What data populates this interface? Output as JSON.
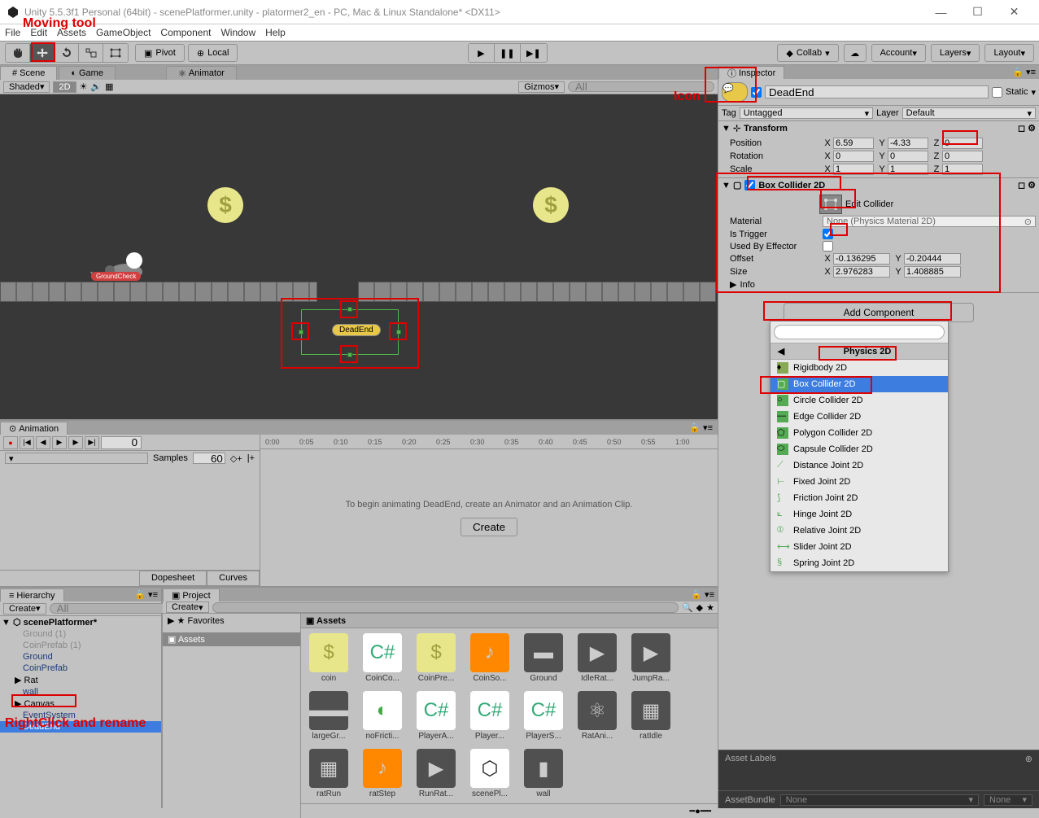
{
  "titlebar": "Unity 5.5.3f1 Personal (64bit) - scenePlatformer.unity - platormer2_en - PC, Mac & Linux Standalone* <DX11>",
  "menu": [
    "File",
    "Edit",
    "Assets",
    "GameObject",
    "Component",
    "Window",
    "Help"
  ],
  "toolbar": {
    "pivot": "Pivot",
    "local": "Local",
    "collab": "Collab",
    "account": "Account",
    "layers": "Layers",
    "layout": "Layout"
  },
  "tabs": {
    "scene": "Scene",
    "game": "Game",
    "animator": "Animator"
  },
  "sceneToolbar": {
    "shaded": "Shaded",
    "mode2d": "2D",
    "gizmos": "Gizmos",
    "searchPh": "All"
  },
  "sceneObjects": {
    "groundCheck": "GroundCheck",
    "deadEnd": "DeadEnd"
  },
  "annotations": {
    "movingTool": "Moving tool",
    "icon": "Icon",
    "rightClick": "RightClick and rename"
  },
  "animation": {
    "tab": "Animation",
    "frame": "0",
    "samples": "Samples",
    "samplesVal": "60",
    "msg": "To begin animating DeadEnd, create an Animator and an Animation Clip.",
    "create": "Create",
    "dopesheet": "Dopesheet",
    "curves": "Curves",
    "ruler": [
      "0:00",
      "0:05",
      "0:10",
      "0:15",
      "0:20",
      "0:25",
      "0:30",
      "0:35",
      "0:40",
      "0:45",
      "0:50",
      "0:55",
      "1:00"
    ]
  },
  "hierarchy": {
    "tab": "Hierarchy",
    "create": "Create",
    "searchPh": "All",
    "root": "scenePlatformer*",
    "items": [
      "Ground (1)",
      "CoinPrefab (1)",
      "Ground",
      "CoinPrefab",
      "Rat",
      "wall",
      "Canvas",
      "EventSystem",
      "DeadEnd"
    ]
  },
  "project": {
    "tab": "Project",
    "create": "Create",
    "favorites": "Favorites",
    "assetsRoot": "Assets",
    "breadcrumb": "Assets",
    "assets": [
      "coin",
      "CoinCo...",
      "CoinPre...",
      "CoinSo...",
      "Ground",
      "IdleRat...",
      "JumpRa...",
      "largeGr...",
      "noFricti...",
      "PlayerA...",
      "Player...",
      "PlayerS...",
      "RatAni...",
      "ratIdle",
      "ratRun",
      "ratStep",
      "RunRat...",
      "scenePl...",
      "wall"
    ]
  },
  "inspector": {
    "tab": "Inspector",
    "name": "DeadEnd",
    "static": "Static",
    "tag": "Tag",
    "tagVal": "Untagged",
    "layer": "Layer",
    "layerVal": "Default",
    "transform": {
      "title": "Transform",
      "position": "Position",
      "rotation": "Rotation",
      "scale": "Scale",
      "pos": {
        "x": "6.59",
        "y": "-4.33",
        "z": "0"
      },
      "rot": {
        "x": "0",
        "y": "0",
        "z": "0"
      },
      "scl": {
        "x": "1",
        "y": "1",
        "z": "1"
      }
    },
    "boxCollider": {
      "title": "Box Collider 2D",
      "editCollider": "Edit Collider",
      "material": "Material",
      "materialVal": "None (Physics Material 2D)",
      "isTrigger": "Is Trigger",
      "usedByEffector": "Used By Effector",
      "offset": "Offset",
      "size": "Size",
      "off": {
        "x": "-0.136295",
        "y": "-0.20444"
      },
      "sz": {
        "x": "2.976283",
        "y": "1.408885"
      },
      "info": "Info"
    },
    "addComponent": "Add Component"
  },
  "dropdown": {
    "title": "Physics 2D",
    "items": [
      "Rigidbody 2D",
      "Box Collider 2D",
      "Circle Collider 2D",
      "Edge Collider 2D",
      "Polygon Collider 2D",
      "Capsule Collider 2D",
      "Distance Joint 2D",
      "Fixed Joint 2D",
      "Friction Joint 2D",
      "Hinge Joint 2D",
      "Relative Joint 2D",
      "Slider Joint 2D",
      "Spring Joint 2D"
    ]
  },
  "assetLabels": "Asset Labels",
  "assetBundle": {
    "label": "AssetBundle",
    "none1": "None",
    "none2": "None"
  }
}
